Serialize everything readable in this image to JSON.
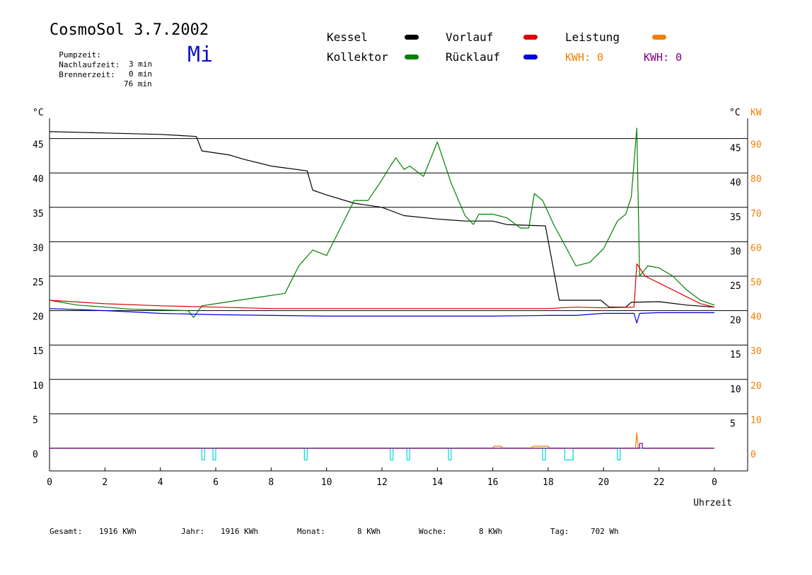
{
  "header": {
    "title": "CosmoSol 3.7.2002",
    "weekday": "Mi",
    "info": [
      {
        "label": "Pumpzeit:",
        "value": "3 min"
      },
      {
        "label": "Nachlaufzeit:",
        "value": "0 min"
      },
      {
        "label": "Brennerzeit:",
        "value": "76 min"
      }
    ]
  },
  "legend": {
    "items": [
      {
        "label": "Kessel",
        "color": "#000000"
      },
      {
        "label": "Vorlauf",
        "color": "#e00000"
      },
      {
        "label": "Leistung",
        "color": "#f08000"
      },
      {
        "label": "Kollektor",
        "color": "#008000"
      },
      {
        "label": "Rücklauf",
        "color": "#0000e0"
      }
    ],
    "kwh1": {
      "text": "KWH: 0",
      "color": "#f08000"
    },
    "kwh2": {
      "text": "KWH: 0",
      "color": "#800080"
    }
  },
  "footer": [
    {
      "label": "Gesamt:",
      "value": "1916 KWh"
    },
    {
      "label": "Jahr:",
      "value": "1916 KWh"
    },
    {
      "label": "Monat:",
      "value": "8 KWh"
    },
    {
      "label": "Woche:",
      "value": "8 KWh"
    },
    {
      "label": "Tag:",
      "value": "702 Wh"
    }
  ],
  "chart_data": {
    "type": "line",
    "xlabel": "Uhrzeit",
    "ylabel_left": "°C",
    "ylabel_right_1": "°C",
    "ylabel_right_2": "KW",
    "xlim": [
      0,
      24
    ],
    "ylim": [
      -3.5,
      48
    ],
    "x_tick_labels": [
      "0",
      "2",
      "4",
      "6",
      "8",
      "10",
      "12",
      "14",
      "16",
      "18",
      "20",
      "22",
      "0"
    ],
    "y_ticks_left": [
      0,
      5,
      10,
      15,
      20,
      25,
      30,
      35,
      40,
      45
    ],
    "y_ticks_right_c": [
      5,
      10,
      15,
      20,
      25,
      30,
      35,
      40,
      45
    ],
    "y_ticks_right_kw": [
      0,
      10,
      20,
      30,
      40,
      50,
      60,
      70,
      80,
      90
    ],
    "grid_y": true,
    "series": [
      {
        "name": "Kessel",
        "color": "#000000",
        "points": [
          [
            0,
            46
          ],
          [
            2,
            45.8
          ],
          [
            4,
            45.6
          ],
          [
            5.3,
            45.3
          ],
          [
            5.5,
            43.2
          ],
          [
            6.5,
            42.6
          ],
          [
            7,
            42
          ],
          [
            8,
            41
          ],
          [
            9.3,
            40.3
          ],
          [
            9.5,
            37.5
          ],
          [
            10,
            36.8
          ],
          [
            11,
            35.6
          ],
          [
            12,
            35
          ],
          [
            12.8,
            33.8
          ],
          [
            14,
            33.3
          ],
          [
            15,
            33
          ],
          [
            16,
            33
          ],
          [
            16.5,
            32.5
          ],
          [
            17.9,
            32.3
          ],
          [
            18.4,
            21.5
          ],
          [
            19.9,
            21.5
          ],
          [
            20.2,
            20.5
          ],
          [
            20.8,
            20.5
          ],
          [
            21,
            21.2
          ],
          [
            22,
            21.3
          ],
          [
            23,
            20.8
          ],
          [
            24,
            20.5
          ]
        ]
      },
      {
        "name": "Kollektor",
        "color": "#008000",
        "points": [
          [
            0,
            21.5
          ],
          [
            1,
            20.8
          ],
          [
            2,
            20.5
          ],
          [
            3,
            20.2
          ],
          [
            4,
            20.1
          ],
          [
            5,
            20
          ],
          [
            5.2,
            19
          ],
          [
            5.5,
            20.7
          ],
          [
            6,
            21
          ],
          [
            7,
            21.6
          ],
          [
            8,
            22.2
          ],
          [
            8.5,
            22.5
          ],
          [
            9,
            26.5
          ],
          [
            9.5,
            28.8
          ],
          [
            10,
            28
          ],
          [
            10.5,
            32
          ],
          [
            11,
            36
          ],
          [
            11.5,
            36
          ],
          [
            12,
            39
          ],
          [
            12.3,
            41
          ],
          [
            12.5,
            42.2
          ],
          [
            12.8,
            40.5
          ],
          [
            13,
            41
          ],
          [
            13.5,
            39.5
          ],
          [
            14,
            44.5
          ],
          [
            14.5,
            38.5
          ],
          [
            15,
            33.8
          ],
          [
            15.3,
            32.5
          ],
          [
            15.5,
            34
          ],
          [
            16,
            34
          ],
          [
            16.5,
            33.5
          ],
          [
            17,
            32
          ],
          [
            17.3,
            32
          ],
          [
            17.5,
            37
          ],
          [
            17.8,
            36
          ],
          [
            18.2,
            32.5
          ],
          [
            19,
            26.5
          ],
          [
            19.5,
            27
          ],
          [
            20,
            29
          ],
          [
            20.5,
            33
          ],
          [
            20.8,
            34
          ],
          [
            21,
            36.5
          ],
          [
            21.2,
            46.5
          ],
          [
            21.3,
            25
          ],
          [
            21.6,
            26.5
          ],
          [
            22,
            26.2
          ],
          [
            22.5,
            25
          ],
          [
            23,
            23
          ],
          [
            23.5,
            21.5
          ],
          [
            24,
            20.8
          ]
        ]
      },
      {
        "name": "Vorlauf",
        "color": "#e00000",
        "points": [
          [
            0,
            21.5
          ],
          [
            2,
            21
          ],
          [
            4,
            20.7
          ],
          [
            6,
            20.5
          ],
          [
            8,
            20.3
          ],
          [
            10,
            20.3
          ],
          [
            12,
            20.3
          ],
          [
            14,
            20.3
          ],
          [
            16,
            20.3
          ],
          [
            18,
            20.3
          ],
          [
            19,
            20.5
          ],
          [
            20,
            20.4
          ],
          [
            21.1,
            20.5
          ],
          [
            21.2,
            26.8
          ],
          [
            21.5,
            25
          ],
          [
            22,
            24
          ],
          [
            22.5,
            23
          ],
          [
            23,
            22
          ],
          [
            23.5,
            21
          ],
          [
            24,
            20.5
          ]
        ]
      },
      {
        "name": "Rücklauf",
        "color": "#0000e0",
        "points": [
          [
            0,
            20.3
          ],
          [
            2,
            20
          ],
          [
            4,
            19.6
          ],
          [
            6,
            19.4
          ],
          [
            8,
            19.3
          ],
          [
            10,
            19.2
          ],
          [
            12,
            19.2
          ],
          [
            14,
            19.2
          ],
          [
            16,
            19.2
          ],
          [
            18,
            19.3
          ],
          [
            19,
            19.3
          ],
          [
            20,
            19.6
          ],
          [
            21.1,
            19.6
          ],
          [
            21.2,
            18.2
          ],
          [
            21.3,
            19.6
          ],
          [
            22,
            19.7
          ],
          [
            24,
            19.7
          ]
        ]
      },
      {
        "name": "Leistung",
        "color": "#f08000",
        "points": [
          [
            0,
            0
          ],
          [
            16,
            0
          ],
          [
            16.05,
            0.3
          ],
          [
            16.3,
            0.3
          ],
          [
            16.35,
            0
          ],
          [
            17.4,
            0
          ],
          [
            17.45,
            0.3
          ],
          [
            18,
            0.3
          ],
          [
            18.05,
            0
          ],
          [
            21.15,
            0
          ],
          [
            21.2,
            2.2
          ],
          [
            21.25,
            0
          ],
          [
            24,
            0
          ]
        ]
      },
      {
        "name": "Pumpe",
        "color": "#00d8d8",
        "points": [
          [
            0,
            0
          ],
          [
            5.5,
            0
          ],
          [
            5.5,
            -1.7
          ],
          [
            5.6,
            -1.7
          ],
          [
            5.6,
            0
          ],
          [
            5.9,
            0
          ],
          [
            5.9,
            -1.7
          ],
          [
            6,
            -1.7
          ],
          [
            6,
            0
          ],
          [
            9.2,
            0
          ],
          [
            9.2,
            -1.7
          ],
          [
            9.3,
            -1.7
          ],
          [
            9.3,
            0
          ],
          [
            12.3,
            0
          ],
          [
            12.3,
            -1.7
          ],
          [
            12.4,
            -1.7
          ],
          [
            12.4,
            0
          ],
          [
            12.9,
            0
          ],
          [
            12.9,
            -1.7
          ],
          [
            13,
            -1.7
          ],
          [
            13,
            0
          ],
          [
            14.4,
            0
          ],
          [
            14.4,
            -1.7
          ],
          [
            14.5,
            -1.7
          ],
          [
            14.5,
            0
          ],
          [
            17.8,
            0
          ],
          [
            17.8,
            -1.7
          ],
          [
            17.9,
            -1.7
          ],
          [
            17.9,
            0
          ],
          [
            18.6,
            0
          ],
          [
            18.6,
            -1.7
          ],
          [
            18.9,
            -1.7
          ],
          [
            18.9,
            0
          ],
          [
            20.5,
            0
          ],
          [
            20.5,
            -1.7
          ],
          [
            20.6,
            -1.7
          ],
          [
            20.6,
            0
          ],
          [
            24,
            0
          ]
        ]
      },
      {
        "name": "Brenner",
        "color": "#800080",
        "points": [
          [
            0,
            0
          ],
          [
            21.3,
            0
          ],
          [
            21.3,
            0.7
          ],
          [
            21.4,
            0.7
          ],
          [
            21.4,
            0
          ],
          [
            24,
            0
          ]
        ]
      }
    ]
  }
}
